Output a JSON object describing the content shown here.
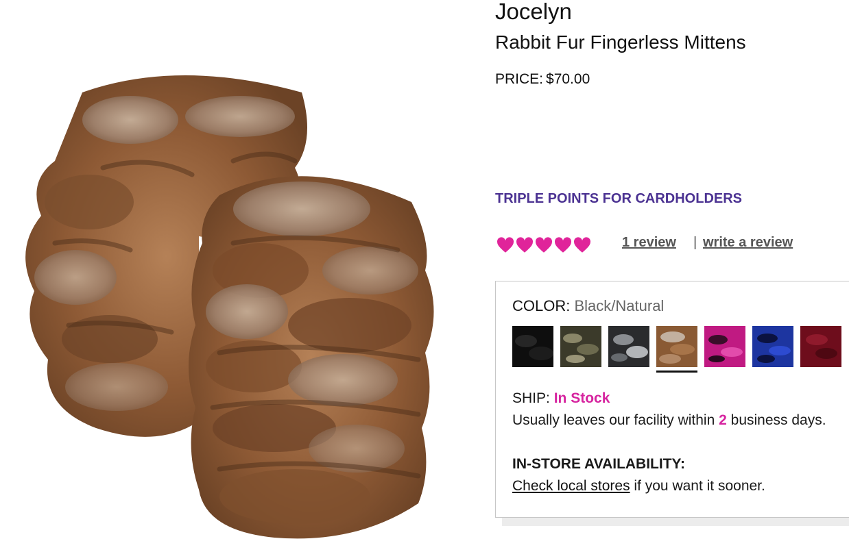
{
  "product": {
    "brand": "Jocelyn",
    "name": "Rabbit Fur Fingerless Mittens",
    "price_label": "PRICE:",
    "price_value": "$70.00"
  },
  "promo": "TRIPLE POINTS FOR CARDHOLDERS",
  "reviews": {
    "rating": 5,
    "max_rating": 5,
    "icon": "heart-icon",
    "heart_color": "#e0249a",
    "count_link": "1 review",
    "separator": "|",
    "write_link": "write a review"
  },
  "color": {
    "label": "COLOR:",
    "selected": "Black/Natural",
    "swatches": [
      {
        "icon": "black-fur-swatch",
        "color": "#0e0e0e"
      },
      {
        "icon": "olive-fur-swatch",
        "color": "#4b4a36"
      },
      {
        "icon": "grey-fur-swatch",
        "color": "#505355"
      },
      {
        "icon": "natural-fur-swatch",
        "color": "#8a6446"
      },
      {
        "icon": "pink-fur-swatch",
        "color": "#c01a82"
      },
      {
        "icon": "blue-fur-swatch",
        "color": "#1d35a0"
      },
      {
        "icon": "burgundy-fur-swatch",
        "color": "#6e0d1c"
      }
    ],
    "selected_index": 3
  },
  "shipping": {
    "label": "SHIP:",
    "status": "In Stock",
    "status_color": "#d6249f",
    "note_before": "Usually leaves our facility within ",
    "days": "2",
    "note_after": " business days."
  },
  "instore": {
    "title": "IN-STORE AVAILABILITY:",
    "link": "Check local stores",
    "suffix": " if you want it sooner."
  }
}
